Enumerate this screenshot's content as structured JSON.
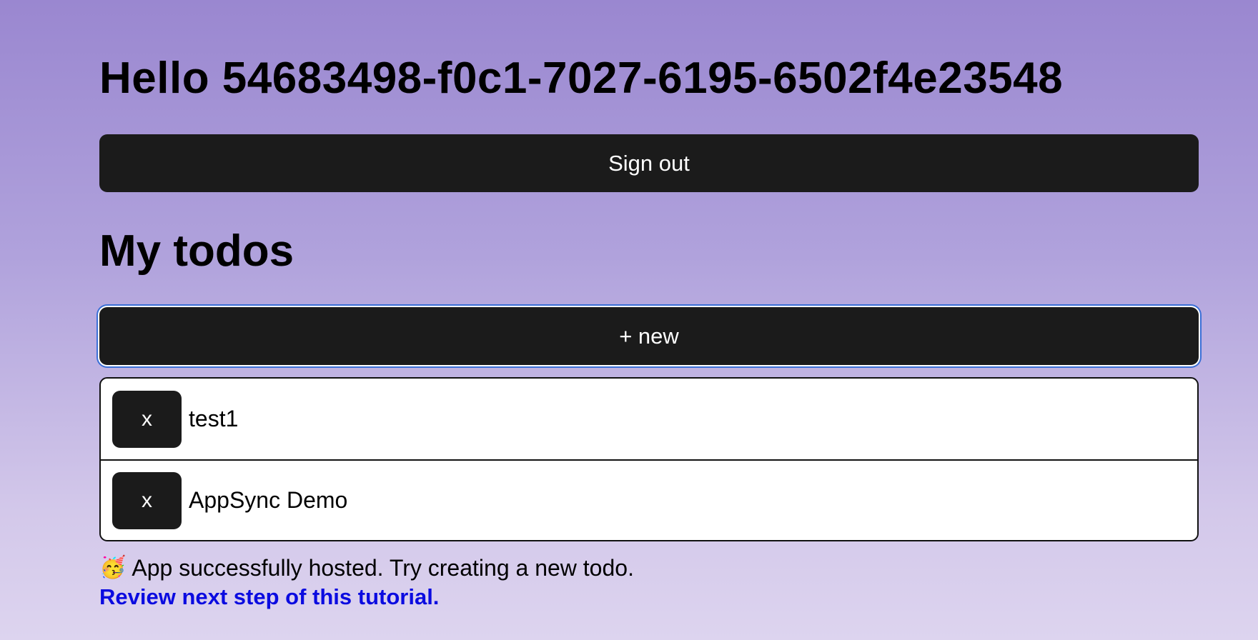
{
  "header": {
    "greeting": "Hello 54683498-f0c1-7027-6195-6502f4e23548",
    "sign_out_label": "Sign out"
  },
  "todos_section": {
    "title": "My todos",
    "new_button_label": "+ new",
    "delete_label": "x",
    "items": [
      {
        "content": "test1"
      },
      {
        "content": "AppSync Demo"
      }
    ]
  },
  "footer": {
    "emoji": "🥳",
    "status_text": "App successfully hosted. Try creating a new todo.",
    "tutorial_link_label": "Review next step of this tutorial."
  },
  "colors": {
    "button_bg": "#1b1b1b",
    "link": "#0b0be0",
    "focus_ring": "#3b6fd6"
  }
}
